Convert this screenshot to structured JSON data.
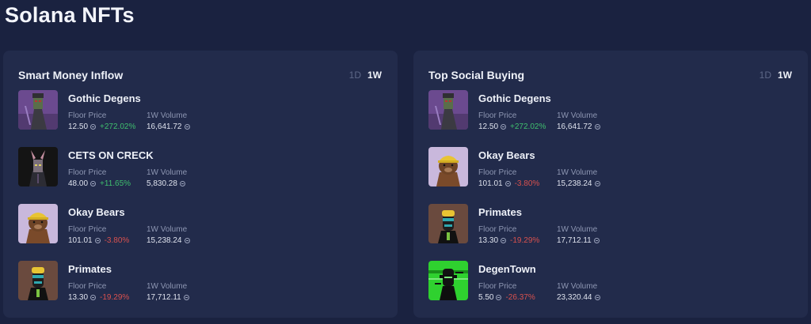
{
  "page": {
    "title": "Solana NFTs"
  },
  "colors": {
    "background": "#1a2240",
    "panel": "#222b4b",
    "positive": "#3fbf6e",
    "negative": "#d9514e"
  },
  "panels": [
    {
      "title": "Smart Money Inflow",
      "ranges": [
        "1D",
        "1W"
      ],
      "active_range": "1W",
      "items": [
        {
          "name": "Gothic Degens",
          "floor_label": "Floor Price",
          "floor": "12.50",
          "change": "+272.02%",
          "direction": "up",
          "volume_label": "1W Volume",
          "volume": "16,641.72",
          "thumb": "gothic"
        },
        {
          "name": "CETS ON CRECK",
          "floor_label": "Floor Price",
          "floor": "48.00",
          "change": "+11.65%",
          "direction": "up",
          "volume_label": "1W Volume",
          "volume": "5,830.28",
          "thumb": "cets"
        },
        {
          "name": "Okay Bears",
          "floor_label": "Floor Price",
          "floor": "101.01",
          "change": "-3.80%",
          "direction": "down",
          "volume_label": "1W Volume",
          "volume": "15,238.24",
          "thumb": "okay"
        },
        {
          "name": "Primates",
          "floor_label": "Floor Price",
          "floor": "13.30",
          "change": "-19.29%",
          "direction": "down",
          "volume_label": "1W Volume",
          "volume": "17,712.11",
          "thumb": "primates"
        }
      ]
    },
    {
      "title": "Top Social Buying",
      "ranges": [
        "1D",
        "1W"
      ],
      "active_range": "1W",
      "items": [
        {
          "name": "Gothic Degens",
          "floor_label": "Floor Price",
          "floor": "12.50",
          "change": "+272.02%",
          "direction": "up",
          "volume_label": "1W Volume",
          "volume": "16,641.72",
          "thumb": "gothic"
        },
        {
          "name": "Okay Bears",
          "floor_label": "Floor Price",
          "floor": "101.01",
          "change": "-3.80%",
          "direction": "down",
          "volume_label": "1W Volume",
          "volume": "15,238.24",
          "thumb": "okay"
        },
        {
          "name": "Primates",
          "floor_label": "Floor Price",
          "floor": "13.30",
          "change": "-19.29%",
          "direction": "down",
          "volume_label": "1W Volume",
          "volume": "17,712.11",
          "thumb": "primates"
        },
        {
          "name": "DegenTown",
          "floor_label": "Floor Price",
          "floor": "5.50",
          "change": "-26.37%",
          "direction": "down",
          "volume_label": "1W Volume",
          "volume": "23,320.44",
          "thumb": "degentown"
        }
      ]
    }
  ]
}
